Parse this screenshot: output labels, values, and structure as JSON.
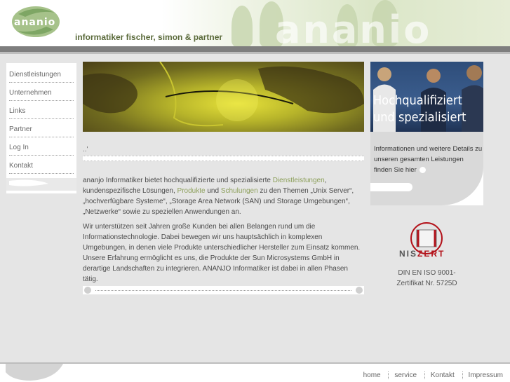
{
  "header": {
    "logo_text": "ananio",
    "tagline": "informatiker fischer, simon & partner",
    "watermark": "ananio"
  },
  "sidebar": {
    "items": [
      {
        "label": "Dienstleistungen"
      },
      {
        "label": "Unternehmen"
      },
      {
        "label": "Links"
      },
      {
        "label": "Partner"
      },
      {
        "label": "Log In"
      },
      {
        "label": "Kontakt"
      }
    ]
  },
  "main": {
    "breadcrumb": "..'",
    "p1_a": "ananjo Informatiker bietet hochqualifizierte und spezialisierte ",
    "p1_link1": "Dienstleistungen",
    "p1_b": ", kundenspezifische Lösungen, ",
    "p1_link2": "Produkte",
    "p1_c": " und ",
    "p1_link3": "Schulungen",
    "p1_d": " zu den Themen „Unix Server“, „hochverfügbare Systeme“, „Storage Area Network (SAN) und Storage Umgebungen“, „Netzwerke“ sowie zu speziellen Anwendungen an.",
    "p2": "Wir unterstützen seit Jahren große Kunden bei allen Belangen rund um die Informationstechnologie. Dabei bewegen wir uns hauptsächlich in komplexen Umgebungen, in denen viele Produkte unterschiedlicher Hersteller zum Einsatz kommen. Unsere Erfahrung ermöglicht es uns, die Produkte der Sun Microsystems GmbH in derartige Landschaften zu integrieren. ANANJO Informatiker ist dabei in allen Phasen tätig."
  },
  "promo": {
    "title_line1": "Hochqualifiziert",
    "title_line2": "und spezialisiert",
    "text": "Informationen und weitere Details zu unseren gesamten Leistungen finden Sie hier"
  },
  "cert": {
    "brand_a": "NIS",
    "brand_b": "ZERT",
    "line1": "DIN EN ISO 9001-",
    "line2": "Zertifikat Nr. 5725D"
  },
  "footer": {
    "links": [
      "home",
      "service",
      "Kontakt",
      "Impressum"
    ]
  },
  "colors": {
    "accent_green": "#8c9f5a",
    "cert_red": "#b3121a",
    "bar_gray": "#7e7e7e"
  }
}
